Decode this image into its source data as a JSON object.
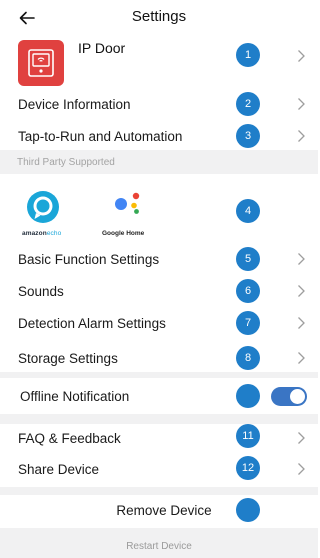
{
  "header": {
    "title": "Settings",
    "back_icon": "arrow-left-icon"
  },
  "device": {
    "name": "IP Door",
    "icon": "ip-door-intercom-icon",
    "icon_color": "#e0413f"
  },
  "badge_color": "#1f7ec9",
  "rows": {
    "device_info": {
      "label": "Device Information",
      "badge": "2"
    },
    "tap_to_run": {
      "label": "Tap-to-Run and Automation",
      "badge": "3"
    },
    "basic_function": {
      "label": "Basic Function Settings",
      "badge": "5"
    },
    "sounds": {
      "label": "Sounds",
      "badge": "6"
    },
    "detection_alarm": {
      "label": "Detection Alarm Settings",
      "badge": "7"
    },
    "storage": {
      "label": "Storage Settings",
      "badge": "8"
    },
    "offline_notification": {
      "label": "Offline Notification",
      "enabled": true,
      "toggle_color": "#3a75c4"
    },
    "faq": {
      "label": "FAQ & Feedback",
      "badge": "11"
    },
    "share": {
      "label": "Share Device",
      "badge": "12"
    }
  },
  "device_badge": "1",
  "third_party": {
    "header": "Third Party Supported",
    "badge": "4",
    "amazon_bold": "amazon",
    "amazon_light": "echo",
    "google": "Google Home"
  },
  "remove": {
    "label": "Remove Device"
  },
  "restart": {
    "label": "Restart Device"
  }
}
